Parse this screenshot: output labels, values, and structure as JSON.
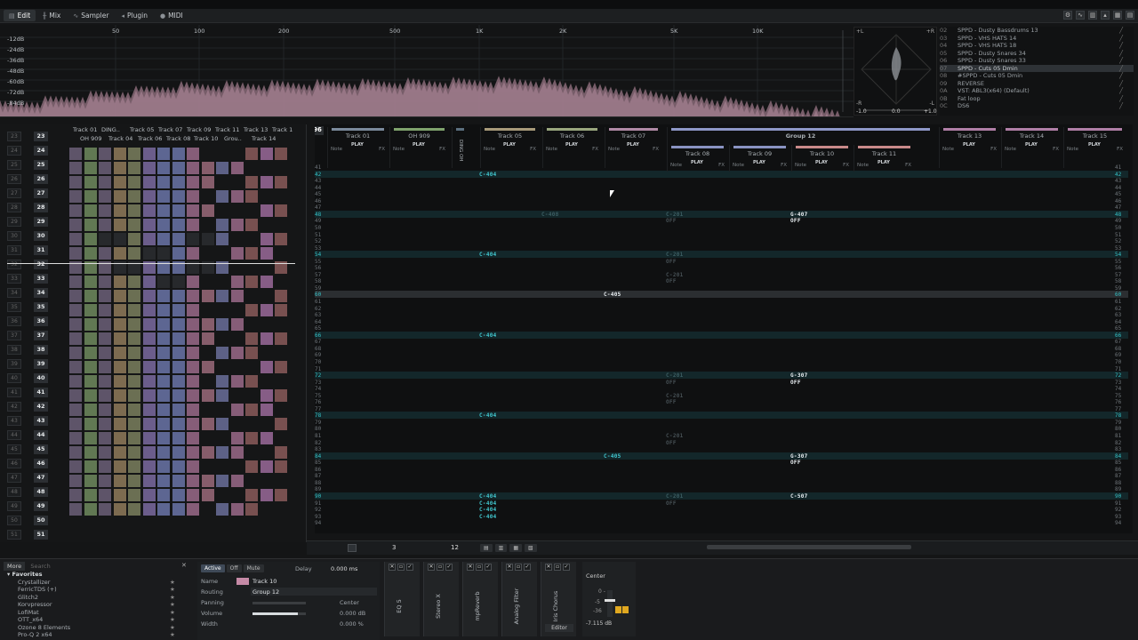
{
  "menu": {
    "tabs": [
      {
        "label": "Edit",
        "icon": "edit-icon",
        "active": true
      },
      {
        "label": "Mix",
        "icon": "mix-icon",
        "active": false
      },
      {
        "label": "Sampler",
        "icon": "sampler-icon",
        "active": false
      },
      {
        "label": "Plugin",
        "icon": "plugin-icon",
        "active": false
      },
      {
        "label": "MIDI",
        "icon": "midi-icon",
        "active": false
      }
    ]
  },
  "spectrum": {
    "db_labels": [
      "-12dB",
      "-24dB",
      "-36dB",
      "-48dB",
      "-60dB",
      "-72dB",
      "-84dB"
    ],
    "freq_labels": [
      "50",
      "100",
      "200",
      "500",
      "1K",
      "2K",
      "5K",
      "10K"
    ],
    "scope_labels": {
      "l": "+L",
      "r": "+R",
      "bl": "-R",
      "br": "-L",
      "v1": "-1.0",
      "v2": "0.0",
      "v3": "+1.0"
    }
  },
  "instruments": [
    {
      "idx": "02",
      "name": "SPPD - Dusty Bassdrums 13",
      "selected": false
    },
    {
      "idx": "03",
      "name": "SPPD - VHS HATS 14",
      "selected": false
    },
    {
      "idx": "04",
      "name": "SPPD - VHS HATS 18",
      "selected": false
    },
    {
      "idx": "05",
      "name": "SPPD - Dusty Snares 34",
      "selected": false
    },
    {
      "idx": "06",
      "name": "SPPD - Dusty Snares 33",
      "selected": false
    },
    {
      "idx": "07",
      "name": "SPPD - Cuts 05 Dmin",
      "selected": true
    },
    {
      "idx": "08",
      "name": "#SPPD - Cuts 05 Dmin",
      "selected": false
    },
    {
      "idx": "09",
      "name": "REVERSE",
      "selected": false
    },
    {
      "idx": "0A",
      "name": "VST: ABL3(x64) (Default)",
      "selected": false
    },
    {
      "idx": "0B",
      "name": "Fat loop",
      "selected": false
    },
    {
      "idx": "0C",
      "name": "DS6",
      "selected": false
    }
  ],
  "sequencer": {
    "track_labels_row1": [
      "Track 01",
      "DING..",
      "Track 05",
      "Track 07",
      "Track 09",
      "Track 11",
      "Track 13",
      "Track 1"
    ],
    "track_labels_row2": [
      "OH 909",
      "Track 04",
      "Track 06",
      "Track 08",
      "Track 10",
      "Grou..",
      "Track 14"
    ],
    "seq_numbers": [
      "23",
      "24",
      "25",
      "26",
      "27",
      "28",
      "29",
      "30",
      "31",
      "32",
      "33",
      "34",
      "35",
      "36",
      "37",
      "38",
      "39",
      "40",
      "41",
      "42",
      "43",
      "44",
      "45",
      "46",
      "47",
      "48",
      "49",
      "50",
      "51"
    ],
    "play_label": "PLAY"
  },
  "pattern": {
    "current_pattern": "96",
    "group_label": "Group 12",
    "tracks": [
      {
        "name": "Track 01",
        "color": "#7b8a9c"
      },
      {
        "name": "OH 909",
        "color": "#7fa36d"
      },
      {
        "name": "DING OH",
        "color": "#5c6f7e"
      },
      {
        "name": "Track 05",
        "color": "#a89a7a"
      },
      {
        "name": "Track 06",
        "color": "#9aa77e"
      },
      {
        "name": "Track 07",
        "color": "#b08aa6"
      },
      {
        "name": "Track 13",
        "color": "#b07fa7"
      },
      {
        "name": "Track 14",
        "color": "#b07fa7"
      },
      {
        "name": "Track 15",
        "color": "#b07fa7"
      }
    ],
    "group_tracks": [
      {
        "name": "Track 08",
        "color": "#8a93c2"
      },
      {
        "name": "Track 09",
        "color": "#8a93c2"
      },
      {
        "name": "Track 10",
        "color": "#c98a8a"
      },
      {
        "name": "Track 11",
        "color": "#c98a8a"
      }
    ],
    "col_labels": {
      "note": "Note",
      "fx": "FX",
      "play": "PLAY"
    },
    "rows_start": 41,
    "rows_end": 94,
    "highlight_rows": [
      42,
      48,
      54,
      60,
      66,
      72,
      78,
      84,
      90
    ],
    "notes": {
      "C-404": "C-404",
      "C-408": "C-408",
      "C-405": "C-405",
      "C-201": "C-201",
      "OFF": "OFF",
      "G-407": "G-407",
      "G-307": "G-307",
      "C-507": "C-507"
    }
  },
  "bottom_tools": {
    "step": "3",
    "octave": "12"
  },
  "favorites": {
    "tabs": [
      "More",
      "Search"
    ],
    "header": "Favorites",
    "items": [
      "Crystallizer",
      "FerricTDS (+)",
      "Glitch2",
      "Korvpressor",
      "LofiMat",
      "OTT_x64",
      "Ozone 8 Elements",
      "Pro-Q 2 x64"
    ]
  },
  "track_props": {
    "buttons": {
      "active": "Active",
      "off": "Off",
      "mute": "Mute"
    },
    "delay_label": "Delay",
    "delay_value": "0.000 ms",
    "name_label": "Name",
    "name_value": "Track 10",
    "routing_label": "Routing",
    "routing_value": "Group 12",
    "panning_label": "Panning",
    "panning_value": "Center",
    "volume_label": "Volume",
    "volume_value": "0.000 dB",
    "width_label": "Width",
    "width_value": "0.000 %"
  },
  "devices": [
    "EQ 5",
    "Stereo X",
    "mpReverb",
    "Analog Filter",
    "Iris Chorus"
  ],
  "devices_editor": "Editor",
  "mixer": {
    "pan": "Center",
    "db_top": "0 -",
    "db_mid": "-5",
    "db_low": "-36",
    "value": "-7.115 dB"
  }
}
